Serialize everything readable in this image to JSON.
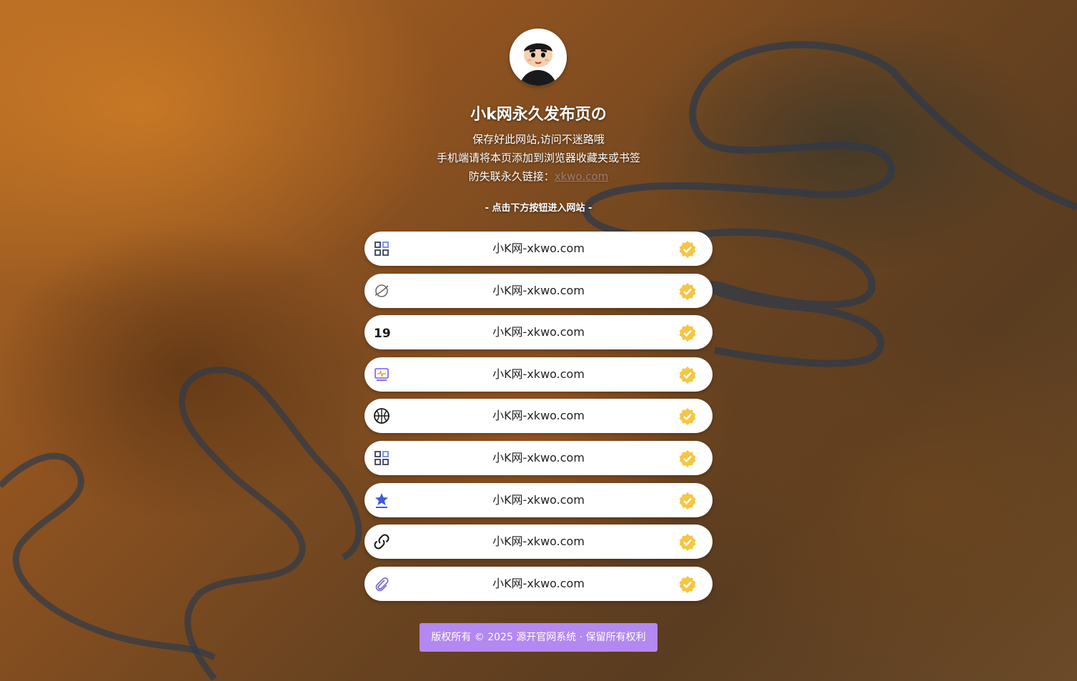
{
  "header": {
    "title": "小k网永久发布页の",
    "line1": "保存好此网站,访问不迷路哦",
    "line2": "手机端请将本页添加到浏览器收藏夹或书签",
    "line3_prefix": "防失联永久链接：",
    "line3_link": "xkwo.com",
    "hint": "- 点击下方按钮进入网站 -"
  },
  "links": [
    {
      "label": "小K网-xkwo.com",
      "icon": "grid-icon"
    },
    {
      "label": "小K网-xkwo.com",
      "icon": "planet-icon"
    },
    {
      "label": "小K网-xkwo.com",
      "icon": "19-logo-icon"
    },
    {
      "label": "小K网-xkwo.com",
      "icon": "monitor-icon"
    },
    {
      "label": "小K网-xkwo.com",
      "icon": "basketball-icon"
    },
    {
      "label": "小K网-xkwo.com",
      "icon": "grid-icon"
    },
    {
      "label": "小K网-xkwo.com",
      "icon": "star-icon"
    },
    {
      "label": "小K网-xkwo.com",
      "icon": "link-icon"
    },
    {
      "label": "小K网-xkwo.com",
      "icon": "paperclip-icon"
    }
  ],
  "footer": {
    "text": "版权所有 © 2025 源开官网系统 · 保留所有权利"
  },
  "colors": {
    "badge": "#f6c542",
    "footer_bg": "#b388f0",
    "link_bg": "#ffffff"
  }
}
